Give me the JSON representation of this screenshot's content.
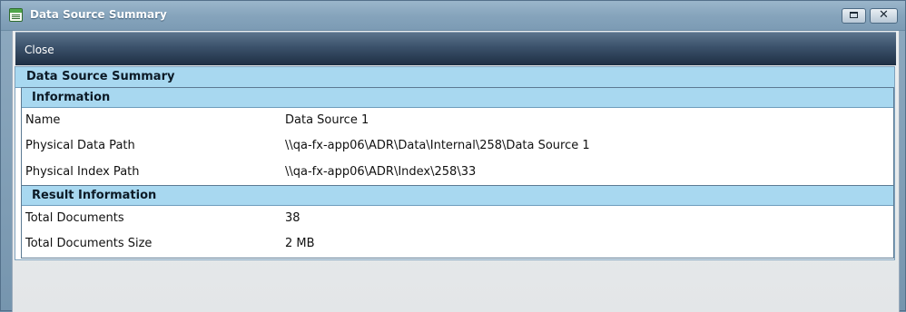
{
  "window": {
    "title": "Data Source Summary",
    "close_glyph": "✕"
  },
  "toolbar": {
    "close_label": "Close"
  },
  "panel": {
    "title": "Data Source Summary"
  },
  "information": {
    "title": "Information",
    "rows": [
      {
        "label": "Name",
        "value": "Data Source 1"
      },
      {
        "label": "Physical Data Path",
        "value": "\\\\qa-fx-app06\\ADR\\Data\\Internal\\258\\Data Source 1"
      },
      {
        "label": "Physical Index Path",
        "value": "\\\\qa-fx-app06\\ADR\\Index\\258\\33"
      }
    ]
  },
  "result_information": {
    "title": "Result Information",
    "rows": [
      {
        "label": "Total Documents",
        "value": "38"
      },
      {
        "label": "Total Documents Size",
        "value": "2 MB"
      }
    ]
  },
  "icons": {
    "app": "data-summary-icon",
    "maximize": "maximize-icon",
    "close": "close-icon"
  }
}
